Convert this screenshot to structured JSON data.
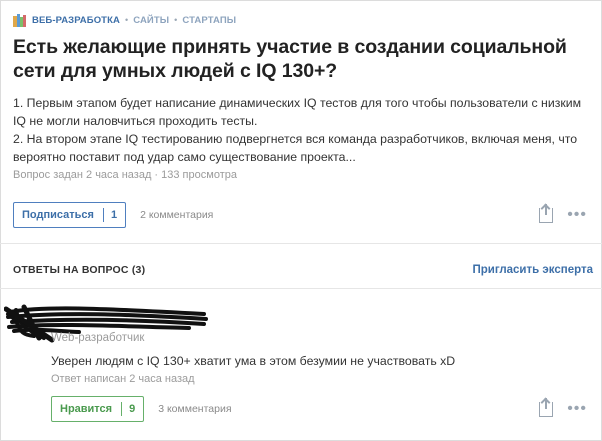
{
  "question": {
    "tags": {
      "first": "ВЕБ-РАЗРАБОТКА",
      "rest": [
        "САЙТЫ",
        "СТАРТАПЫ"
      ],
      "separator": "•"
    },
    "title": "Есть желающие принять участие в создании социальной сети для умных людей с IQ 130+?",
    "body": [
      "1. Первым этапом будет написание динамических IQ тестов для того чтобы пользователи с низким IQ не могли наловчиться проходить тесты.",
      "2. На втором этапе IQ тестированию подвергнется вся команда разработчиков, включая меня, что вероятно поставит под удар само существование проекта..."
    ],
    "meta": "Вопрос задан 2 часа назад · 133 просмотра",
    "subscribe_label": "Подписаться",
    "subscribe_count": "1",
    "comments_label": "2 комментария",
    "more_label": "•••"
  },
  "answers": {
    "title": "ОТВЕТЫ НА ВОПРОС (3)",
    "invite_label": "Пригласить эксперта",
    "items": [
      {
        "author_role": "Web-разработчик",
        "text": "Уверен людям с IQ 130+ хватит ума в этом безумии не участвовать xD",
        "meta": "Ответ написан 2 часа назад",
        "like_label": "Нравится",
        "like_count": "9",
        "comments_label": "3 комментария",
        "more_label": "•••"
      }
    ]
  },
  "colors": {
    "accent_blue": "#3d6fa8",
    "accent_green": "#4a9a4e",
    "muted": "#9b9b9b"
  },
  "icons": {
    "tag": "books-icon",
    "share": "share-icon",
    "more": "more-icon"
  }
}
